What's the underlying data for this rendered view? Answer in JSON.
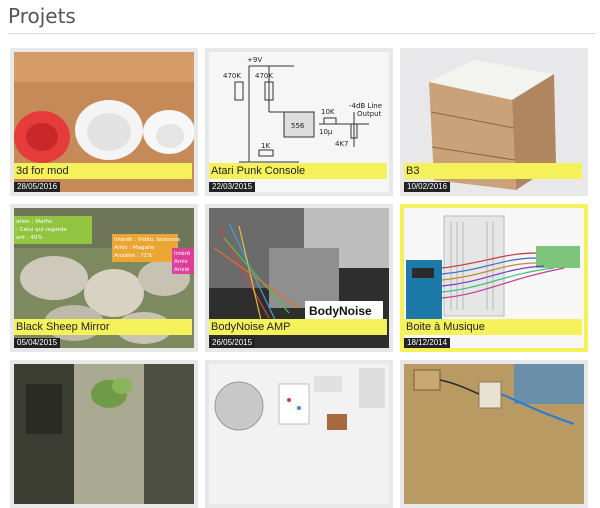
{
  "page": {
    "title": "Projets"
  },
  "projects": [
    {
      "name": "3d for mod",
      "date": "28/05/2016",
      "thumb": "white-mod-disc-photo",
      "selected": false
    },
    {
      "name": "Atari Punk Console",
      "date": "22/03/2015",
      "thumb": "schematic-photo",
      "selected": false
    },
    {
      "name": "B3",
      "date": "10/02/2016",
      "thumb": "wooden-cube-photo",
      "selected": false
    },
    {
      "name": "Black Sheep Mirror",
      "date": "05/04/2015",
      "thumb": "sheep-photo",
      "selected": false
    },
    {
      "name": "BodyNoise AMP",
      "date": "26/05/2015",
      "thumb": "bodynoise-collage",
      "selected": false
    },
    {
      "name": "Boite à Musique",
      "date": "18/12/2014",
      "thumb": "arduino-breadboard",
      "selected": true
    },
    {
      "name": "",
      "date": "",
      "thumb": "window-plant-photo",
      "selected": false
    },
    {
      "name": "",
      "date": "",
      "thumb": "components-flatlay",
      "selected": false
    },
    {
      "name": "",
      "date": "",
      "thumb": "wooden-modules-photo",
      "selected": false
    }
  ],
  "overlays": {
    "schematic": {
      "v9": "+9V",
      "r1": "470K",
      "r2": "470K",
      "chip": "556",
      "r3": "10K",
      "c": "10µ",
      "r4": "4K7",
      "r5": "1K",
      "out1": "-4dB Line",
      "out2": "Output"
    },
    "sheep": {
      "tag1": [
        "ation : Maths",
        ": Celui qui regarde",
        "ant : 40%"
      ],
      "tag2": [
        "Intérêt : Vidéo, boissons",
        "Amis : Magalie",
        "Anxiété : 71%"
      ],
      "tag3": [
        "Intérê",
        "Amis",
        "Anxié"
      ]
    },
    "bodynoise": {
      "logo": "BodyNoise"
    }
  }
}
